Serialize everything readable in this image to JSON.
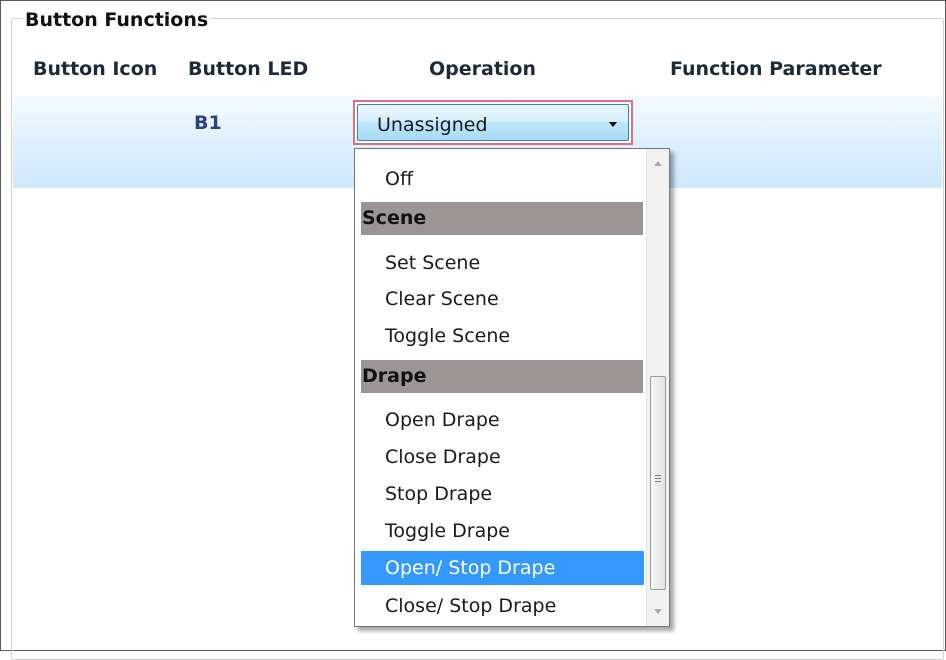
{
  "group": {
    "title": "Button Functions"
  },
  "table": {
    "headers": {
      "button_icon": "Button Icon",
      "button_led": "Button LED",
      "operation": "Operation",
      "function_parameter": "Function Parameter"
    },
    "rows": [
      {
        "button_led": "B1",
        "operation": "Unassigned"
      }
    ]
  },
  "dropdown": {
    "items": [
      {
        "label": "Off"
      },
      {
        "label": "Scene"
      },
      {
        "label": "Set Scene"
      },
      {
        "label": "Clear Scene"
      },
      {
        "label": "Toggle Scene"
      },
      {
        "label": "Drape"
      },
      {
        "label": "Open Drape"
      },
      {
        "label": "Close Drape"
      },
      {
        "label": "Stop Drape"
      },
      {
        "label": "Toggle Drape"
      },
      {
        "label": "Open/ Stop Drape"
      },
      {
        "label": "Close/ Stop Drape"
      }
    ]
  },
  "colors": {
    "highlight": "#3399ff",
    "category_bg": "#9b9595",
    "focus_border": "#e0707f",
    "row_bg": "#dcefff"
  }
}
